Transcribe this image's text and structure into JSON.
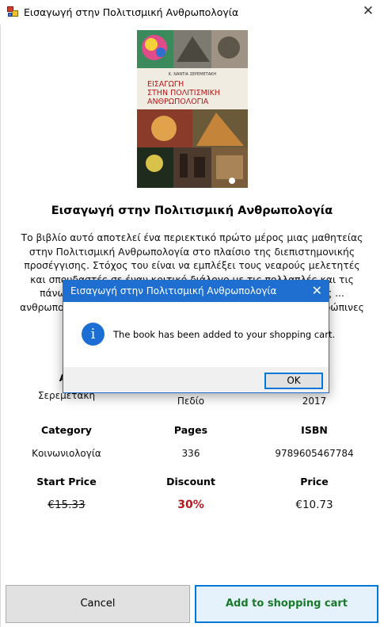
{
  "window": {
    "title": "Εισαγωγή στην Πολιτισμική Ανθρωπολογία",
    "close_glyph": "✕"
  },
  "cover": {
    "author": "Κ. ΝΑΝΤΙΑ ΣΕΡΕΜΕΤΑΚΗ",
    "title_lines": [
      "ΕΙΣΑΓΩΓΗ",
      "ΣΤΗΝ ΠΟΛΙΤΙΣΜΙΚΗ",
      "ΑΝΘΡΩΠΟΛΟΓΙΑ"
    ]
  },
  "book": {
    "title": "Εισαγωγή στην Πολιτισμική Ανθρωπολογία",
    "description": "Το βιβλίο αυτό αποτελεί ένα περιεκτικό πρώτο μέρος μιας μαθητείας στην Πολιτισμική Ανθρωπολογία στο πλαίσιο της διεπιστημονικής προσέγγισης. Στόχος του είναι να εμπλέξει τους νεαρούς μελετητές και σπουδαστές σε έναν κριτικό διάλογο με τις πολλαπλές και τις πάνω στις επικαίρες συζητήσεις στις πολιτισμικές σπουδές ... ανθρωπολογίας ... ορθόδοξων ανθρωπολογικών ... για τις ανθρώπινες ... ες και μεθο... ή"
  },
  "details": {
    "row1": {
      "headers": [
        "Au",
        "",
        "hed"
      ],
      "values": [
        "Σερεμετάκη",
        "Πεδίο",
        "2017"
      ]
    },
    "row2": {
      "headers": [
        "Category",
        "Pages",
        "ISBN"
      ],
      "values": [
        "Κοινωνιολογία",
        "336",
        "9789605467784"
      ]
    },
    "row3": {
      "headers": [
        "Start Price",
        "Discount",
        "Price"
      ],
      "values": [
        "€15.33",
        "30%",
        "€10.73"
      ]
    }
  },
  "dialog": {
    "title": "Εισαγωγή στην Πολιτισμική Ανθρωπολογία",
    "close_glyph": "✕",
    "icon_glyph": "i",
    "message": "The book has been added to your shopping cart.",
    "ok_label": "OK"
  },
  "buttons": {
    "cancel": "Cancel",
    "add_to_cart": "Add to shopping cart"
  },
  "colors": {
    "dialog_accent": "#1e6fd0",
    "discount": "#b3191b",
    "add_button_text": "#1a7a2a"
  }
}
